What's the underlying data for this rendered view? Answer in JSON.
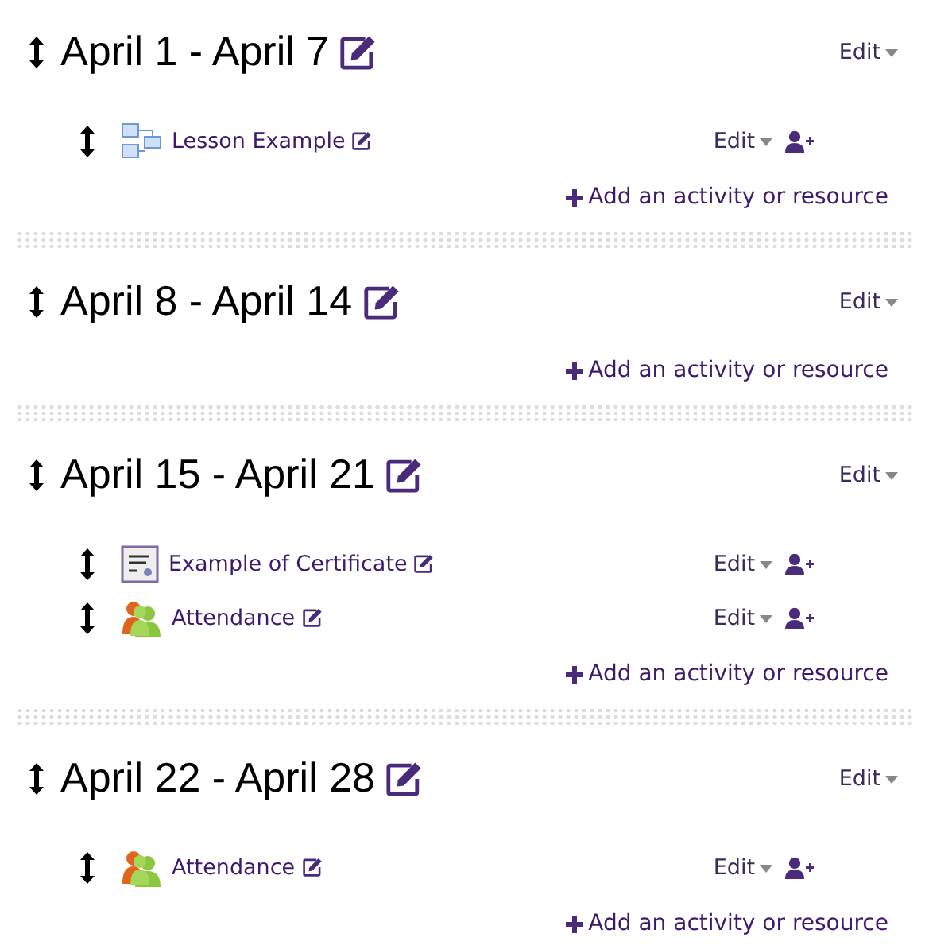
{
  "sections": [
    {
      "title": "April 1 - April 7",
      "edit": "Edit",
      "activities": [
        {
          "kind": "lesson",
          "name": "Lesson Example",
          "edit": "Edit"
        }
      ],
      "add": "Add an activity or resource"
    },
    {
      "title": "April 8 - April 14",
      "edit": "Edit",
      "add": "Add an activity or resource"
    },
    {
      "title": "April 15 - April 21",
      "edit": "Edit",
      "activities": [
        {
          "kind": "certificate",
          "name": "Example of Certificate",
          "edit": "Edit"
        },
        {
          "kind": "attendance",
          "name": "Attendance",
          "edit": "Edit"
        }
      ],
      "add": "Add an activity or resource"
    },
    {
      "title": "April 22 - April 28",
      "edit": "Edit",
      "activities": [
        {
          "kind": "attendance",
          "name": "Attendance",
          "edit": "Edit"
        }
      ],
      "add": "Add an activity or resource"
    }
  ]
}
